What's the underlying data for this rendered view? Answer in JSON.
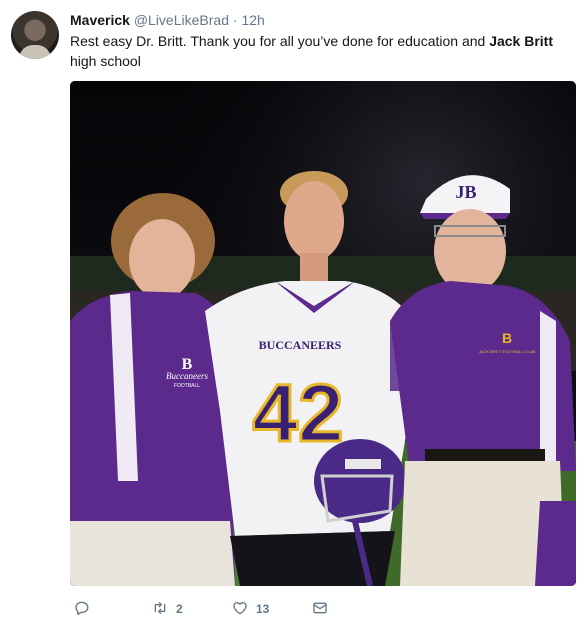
{
  "author": {
    "name": "Maverick",
    "handle": "@LiveLikeBrad",
    "separator": "·",
    "time": "12h"
  },
  "tweet": {
    "text_1": "Rest easy Dr. Britt. Thank you for all you’ve done for education and ",
    "text_bold": "Jack Britt",
    "text_2": " high school"
  },
  "photo": {
    "jersey_team": "BUCCANEERS",
    "jersey_number": "42",
    "cap_letters": "JB",
    "shirt_left_letter": "B",
    "shirt_left_team": "Buccaneers",
    "shirt_left_sub": "FOOTBALL",
    "shirt_right_letter": "B",
    "shirt_right_sub": "JACK BRITT FOOTBALL CLUB"
  },
  "actions": {
    "reply_count": "",
    "retweet_count": "2",
    "like_count": "13"
  },
  "icons": [
    "reply-icon",
    "retweet-icon",
    "like-icon",
    "message-icon"
  ],
  "colors": {
    "purple": "#5b2a8c",
    "gold": "#e8b82a",
    "muted": "#657786"
  }
}
